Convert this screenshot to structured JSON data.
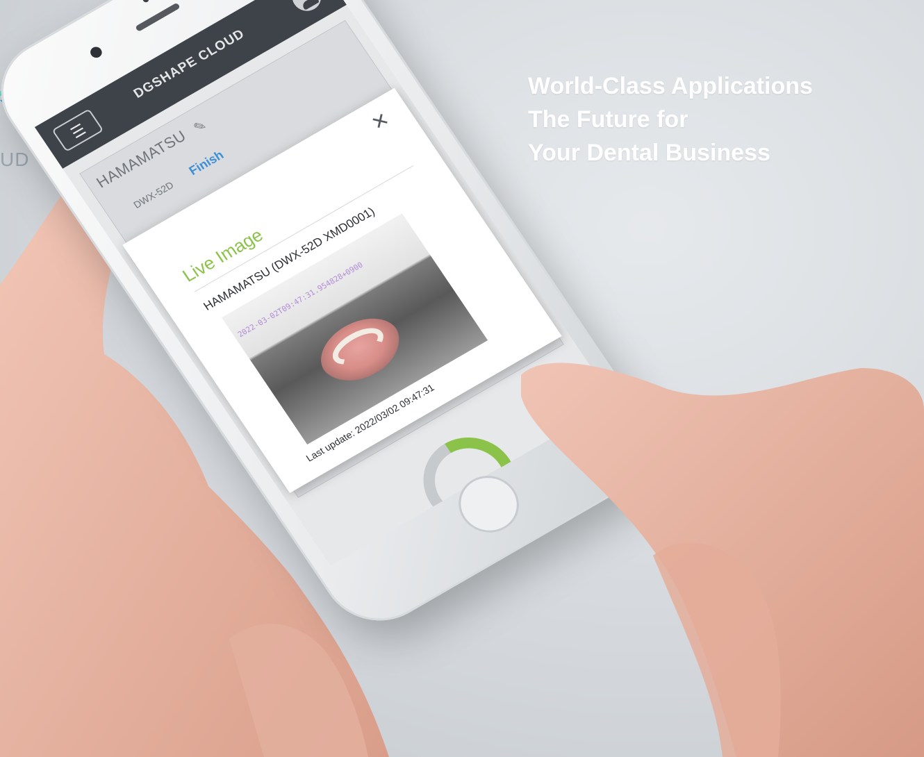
{
  "brand": {
    "logo_text": "UD",
    "accent_colors": [
      "#6ed3c4",
      "#3f9fd6"
    ]
  },
  "headline": {
    "line1": "World-Class Applications",
    "line2": "The Future for",
    "line3": "Your Dental Business"
  },
  "app": {
    "title": "DGSHAPE CLOUD",
    "menu_icon": "hamburger-icon",
    "user_icon": "user-avatar-icon",
    "location_name": "HAMAMATSU",
    "edit_icon": "pencil-icon",
    "machine_label": "DWX-52D",
    "machine_status": "Finish",
    "accent_color": "#8bc34a",
    "status_color": "#3d8fd6",
    "progress_percent": 40
  },
  "modal": {
    "title": "Live Image",
    "close_icon": "close-icon",
    "device_name": "HAMAMATSU (DWX-52D XMD0001)",
    "image_timestamp": "2022-03-02T09:47:31.954828+0900",
    "last_update": "Last update: 2022/03/02 09:47:31"
  }
}
